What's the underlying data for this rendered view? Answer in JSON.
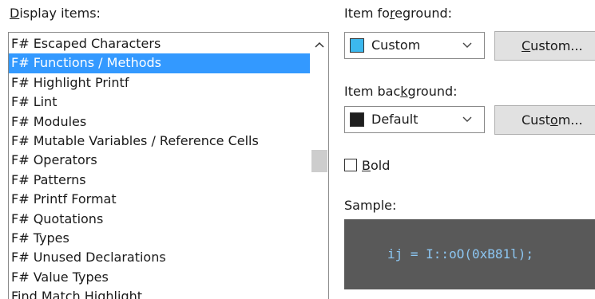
{
  "display_items": {
    "label": "Display items:",
    "items": [
      "F# Escaped Characters",
      "F# Functions / Methods",
      "F# Highlight Printf",
      "F# Lint",
      "F# Modules",
      "F# Mutable Variables / Reference Cells",
      "F# Operators",
      "F# Patterns",
      "F# Printf Format",
      "F# Quotations",
      "F# Types",
      "F# Unused Declarations",
      "F# Value Types",
      "Find Match Highlight"
    ],
    "selected_index": 1
  },
  "foreground": {
    "label": "Item foreground:",
    "value": "Custom",
    "swatch_color": "#3cb8ee",
    "button_label": "Custom..."
  },
  "background": {
    "label": "Item background:",
    "value": "Default",
    "swatch_color": "#1e1e1e",
    "button_label": "Custom..."
  },
  "bold": {
    "label": "Bold",
    "checked": false
  },
  "sample": {
    "label": "Sample:",
    "code": "ij = I::oO(0xB81l);",
    "background": "#595959",
    "text_color": "#8cc6f2"
  },
  "colors": {
    "selection": "#3399ff"
  }
}
